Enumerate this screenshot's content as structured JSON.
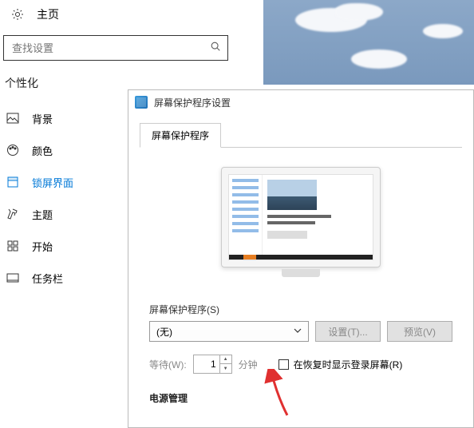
{
  "settings": {
    "title": "主页",
    "search_placeholder": "查找设置",
    "category": "个性化",
    "nav": [
      {
        "label": "背景"
      },
      {
        "label": "颜色"
      },
      {
        "label": "锁屏界面"
      },
      {
        "label": "主题"
      },
      {
        "label": "开始"
      },
      {
        "label": "任务栏"
      }
    ]
  },
  "dialog": {
    "title": "屏幕保护程序设置",
    "tab": "屏幕保护程序",
    "saver_label": "屏幕保护程序(S)",
    "saver_value": "(无)",
    "btn_settings": "设置(T)...",
    "btn_preview": "预览(V)",
    "wait_label": "等待(W):",
    "wait_value": "1",
    "minutes": "分钟",
    "resume_label": "在恢复时显示登录屏幕(R)",
    "power_header": "电源管理"
  }
}
